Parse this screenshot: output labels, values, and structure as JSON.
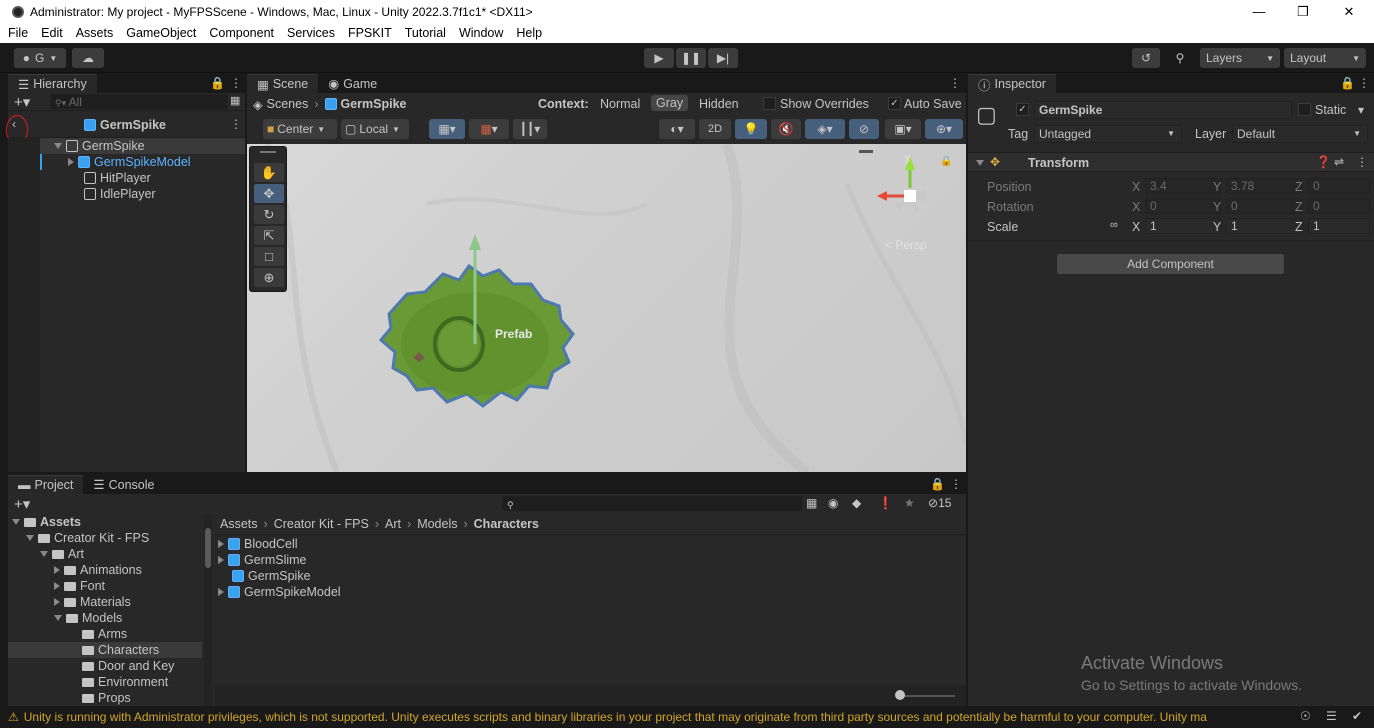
{
  "window": {
    "title": "Administrator: My project - MyFPSScene - Windows, Mac, Linux - Unity 2022.3.7f1c1* <DX11>"
  },
  "menu": [
    "File",
    "Edit",
    "Assets",
    "GameObject",
    "Component",
    "Services",
    "FPSKIT",
    "Tutorial",
    "Window",
    "Help"
  ],
  "toolbar": {
    "account_label": "G",
    "layers_label": "Layers",
    "layout_label": "Layout"
  },
  "hierarchy": {
    "tab": "Hierarchy",
    "search_placeholder": "All",
    "scene_title": "GermSpike",
    "items": [
      {
        "label": "GermSpike"
      },
      {
        "label": "GermSpikeModel"
      },
      {
        "label": "HitPlayer"
      },
      {
        "label": "IdlePlayer"
      }
    ]
  },
  "scene": {
    "tabs": [
      "Scene",
      "Game"
    ],
    "breadcrumb": [
      "Scenes",
      "GermSpike"
    ],
    "context_label": "Context:",
    "context_modes": [
      "Normal",
      "Gray",
      "Hidden"
    ],
    "show_overrides": "Show Overrides",
    "auto_save": "Auto Save",
    "pivot": "Center",
    "space": "Local",
    "mode_2d": "2D",
    "prefab_label": "Prefab",
    "gizmo_axis": "y",
    "persp_label": "Persp"
  },
  "inspector": {
    "tab": "Inspector",
    "object_name": "GermSpike",
    "static_label": "Static",
    "tag_label": "Tag",
    "tag_value": "Untagged",
    "layer_label": "Layer",
    "layer_value": "Default",
    "transform_title": "Transform",
    "position_label": "Position",
    "rotation_label": "Rotation",
    "scale_label": "Scale",
    "position": {
      "x": "3.4",
      "y": "3.78",
      "z": "0"
    },
    "rotation": {
      "x": "0",
      "y": "0",
      "z": "0"
    },
    "scale": {
      "x": "1",
      "y": "1",
      "z": "1"
    },
    "axis": {
      "x": "X",
      "y": "Y",
      "z": "Z"
    },
    "add_component": "Add Component"
  },
  "project": {
    "tabs": [
      "Project",
      "Console"
    ],
    "hidden_count": "15",
    "tree": [
      {
        "label": "Assets"
      },
      {
        "label": "Creator Kit - FPS"
      },
      {
        "label": "Art"
      },
      {
        "label": "Animations"
      },
      {
        "label": "Font"
      },
      {
        "label": "Materials"
      },
      {
        "label": "Models"
      },
      {
        "label": "Arms"
      },
      {
        "label": "Characters"
      },
      {
        "label": "Door and Key"
      },
      {
        "label": "Environment"
      },
      {
        "label": "Props"
      }
    ],
    "breadcrumb": [
      "Assets",
      "Creator Kit - FPS",
      "Art",
      "Models",
      "Characters"
    ],
    "files": [
      {
        "label": "BloodCell"
      },
      {
        "label": "GermSlime"
      },
      {
        "label": "GermSpike"
      },
      {
        "label": "GermSpikeModel"
      }
    ]
  },
  "activation": {
    "title": "Activate Windows",
    "subtitle": "Go to Settings to activate Windows."
  },
  "status": {
    "message": "Unity is running with Administrator privileges, which is not supported. Unity executes scripts and binary libraries in your project that may originate from third party sources and potentially be harmful to your computer. Unity ma"
  },
  "colors": {
    "accent": "#3aa0f0",
    "selection": "#2c5d87",
    "warning": "#d2a62a",
    "model_green": "#6a9a35"
  },
  "icons": [
    "unity-logo-icon",
    "account-icon",
    "cloud-icon",
    "play-icon",
    "pause-icon",
    "step-icon",
    "history-icon",
    "search-icon",
    "lock-icon",
    "menu-icon",
    "gear-icon",
    "help-icon"
  ]
}
